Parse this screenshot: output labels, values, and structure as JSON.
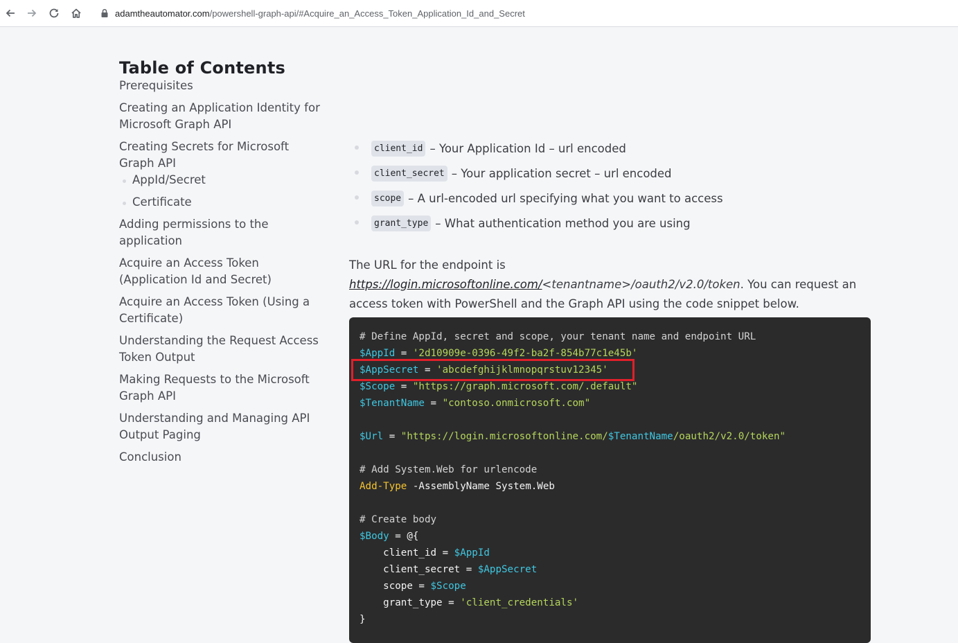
{
  "browser": {
    "url_host": "adamtheautomator.com",
    "url_path": "/powershell-graph-api/#Acquire_an_Access_Token_Application_Id_and_Secret",
    "icons": [
      "back-icon",
      "forward-icon",
      "reload-icon",
      "home-icon",
      "lock-icon"
    ]
  },
  "toc": {
    "title": "Table of Contents",
    "items": [
      "Prerequisites",
      "Creating an Application Identity for Microsoft Graph API",
      "Creating Secrets for Microsoft Graph API",
      "Adding permissions to the application",
      "Acquire an Access Token (Application Id and Secret)",
      "Acquire an Access Token (Using a Certificate)",
      "Understanding the Request Access Token Output",
      "Making Requests to the Microsoft Graph API",
      "Understanding and Managing API Output Paging",
      "Conclusion"
    ],
    "subitems": [
      "AppId/Secret",
      "Certificate"
    ]
  },
  "params": [
    {
      "code": "client_id",
      "desc": "– Your Application Id – url encoded"
    },
    {
      "code": "client_secret",
      "desc": "– Your application secret – url encoded"
    },
    {
      "code": "scope",
      "desc": "– A url-encoded url specifying what you want to access"
    },
    {
      "code": "grant_type",
      "desc": "– What authentication method you are using"
    }
  ],
  "paragraph": {
    "lead": "The URL for the endpoint is",
    "link": "https://login.microsoftonline.com/",
    "tenant": "<tenantname>",
    "path": "/oauth2/v2.0/token",
    "tail": ". You can request an access token with PowerShell and the Graph API using the code snippet below."
  },
  "code": {
    "line1": "# Define AppId, secret and scope, your tenant name and endpoint URL",
    "appid_var": "$AppId",
    "appid_val": "'2d10909e-0396-49f2-ba2f-854b77c1e45b'",
    "secret_var": "$AppSecret",
    "secret_val": "'abcdefghijklmnopqrstuv12345'",
    "scope_var": "$Scope",
    "scope_val": "\"https://graph.microsoft.com/.default\"",
    "tenant_var": "$TenantName",
    "tenant_val": "\"contoso.onmicrosoft.com\"",
    "url_var": "$Url",
    "url_val_a": "\"https://login.microsoftonline.com/",
    "url_val_var": "$TenantName",
    "url_val_b": "/oauth2/v2.0/token\"",
    "comment2": "# Add System.Web for urlencode",
    "cmd": "Add-Type",
    "cmd_param": "-AssemblyName",
    "cmd_arg": "System.Web",
    "comment3": "# Create body",
    "body_var": "$Body",
    "body_open": "@{",
    "k1": "client_id",
    "v1": "$AppId",
    "k2": "client_secret",
    "v2": "$AppSecret",
    "k3": "scope",
    "v3": "$Scope",
    "k4": "grant_type",
    "v4": "'client_credentials'",
    "body_close": "}"
  }
}
